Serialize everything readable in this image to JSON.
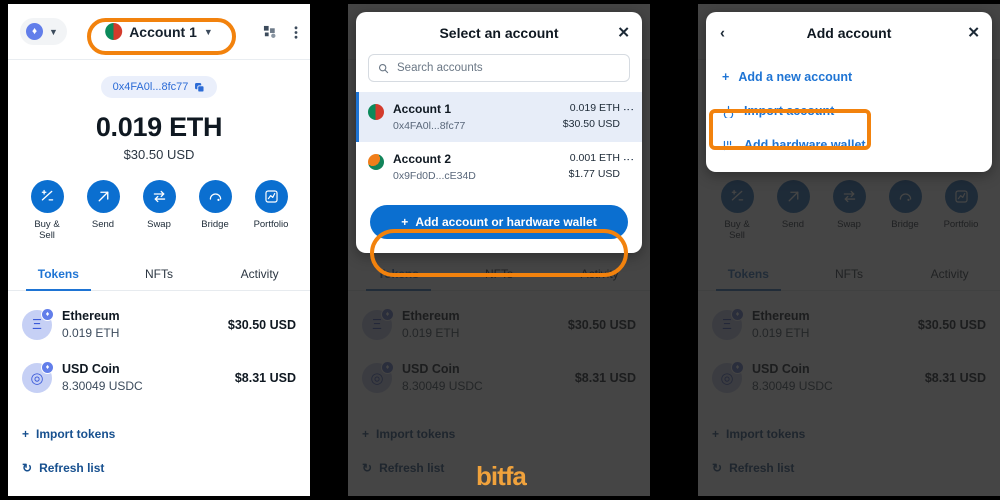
{
  "wallet": {
    "network_label": "Ethereum Mainnet",
    "account_name": "Account 1",
    "account_name_2": "Account 2",
    "address_short": "0x4FA0l...8fc77",
    "balance": "0.019 ETH",
    "fiat_balance": "$30.50 USD",
    "actions": [
      {
        "label": "Buy & Sell",
        "icon": "buy-sell-icon"
      },
      {
        "label": "Send",
        "icon": "send-arrow-icon"
      },
      {
        "label": "Swap",
        "icon": "swap-icon"
      },
      {
        "label": "Bridge",
        "icon": "bridge-icon"
      },
      {
        "label": "Portfolio",
        "icon": "portfolio-chart-icon"
      }
    ],
    "tabs": [
      {
        "label": "Tokens",
        "active": true
      },
      {
        "label": "NFTs",
        "active": false
      },
      {
        "label": "Activity",
        "active": false
      }
    ],
    "tokens": [
      {
        "name": "Ethereum",
        "amount": "0.019 ETH",
        "fiat": "$30.50 USD",
        "symbol": "Ξ"
      },
      {
        "name": "USD Coin",
        "amount": "8.30049 USDC",
        "fiat": "$8.31 USD",
        "symbol": "◎"
      }
    ],
    "import_tokens_label": "Import tokens",
    "refresh_list_label": "Refresh list"
  },
  "select_account_modal": {
    "title": "Select an account",
    "close_label": "✕",
    "search_placeholder": "Search accounts",
    "accounts": [
      {
        "name": "Account 1",
        "address": "0x4FA0l...8fc77",
        "eth": "0.019 ETH",
        "usd": "$30.50 USD",
        "selected": true
      },
      {
        "name": "Account 2",
        "address": "0x9Fd0D...cE34D",
        "eth": "0.001 ETH",
        "usd": "$1.77 USD",
        "selected": false
      }
    ],
    "add_account_button": "Add account or hardware wallet"
  },
  "add_account_modal": {
    "title": "Add account",
    "back_label": "‹",
    "close_label": "✕",
    "items": [
      {
        "label": "Add a new account",
        "icon": "plus-icon",
        "highlighted": false
      },
      {
        "label": "Import account",
        "icon": "import-icon",
        "highlighted": true
      },
      {
        "label": "Add hardware wallet",
        "icon": "hardware-wallet-icon",
        "highlighted": false
      }
    ]
  },
  "watermark": {
    "text": "bitfa"
  },
  "colors": {
    "accent_blue": "#0b6fd0",
    "link_blue": "#1e74d4",
    "highlight_orange": "#f2820d",
    "overlay": "#5a5a5a"
  }
}
